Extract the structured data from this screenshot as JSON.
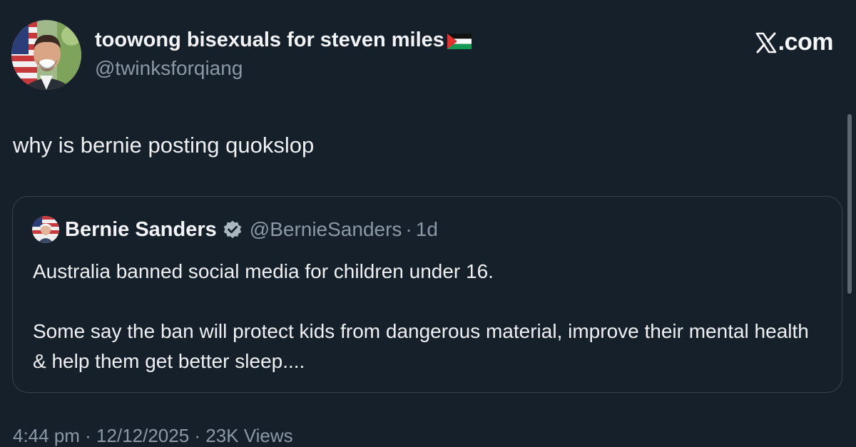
{
  "author": {
    "display_name": "toowong bisexuals for steven miles",
    "handle": "@twinksforqiang",
    "flag_emoji": "palestine-flag"
  },
  "brand": {
    "label": ".com",
    "logo_icon": "x-logo-icon"
  },
  "tweet": {
    "text": "why is bernie posting quokslop"
  },
  "quote": {
    "author_name": "Bernie Sanders",
    "verified_icon": "verified-badge-icon",
    "handle": "@BernieSanders",
    "separator": "·",
    "time": "1d",
    "paragraph1": "Australia banned social media for children under 16.",
    "paragraph2": "Some say the ban will protect kids from dangerous material, improve their mental health & help them get better sleep...."
  },
  "footer": {
    "meta": "4:44 pm · 12/12/2025 · 23K Views"
  },
  "colors": {
    "background": "#16202b",
    "text": "#e7e9ea",
    "muted": "#8b98a5",
    "border": "#38444d",
    "verified": "#aab8c2"
  }
}
